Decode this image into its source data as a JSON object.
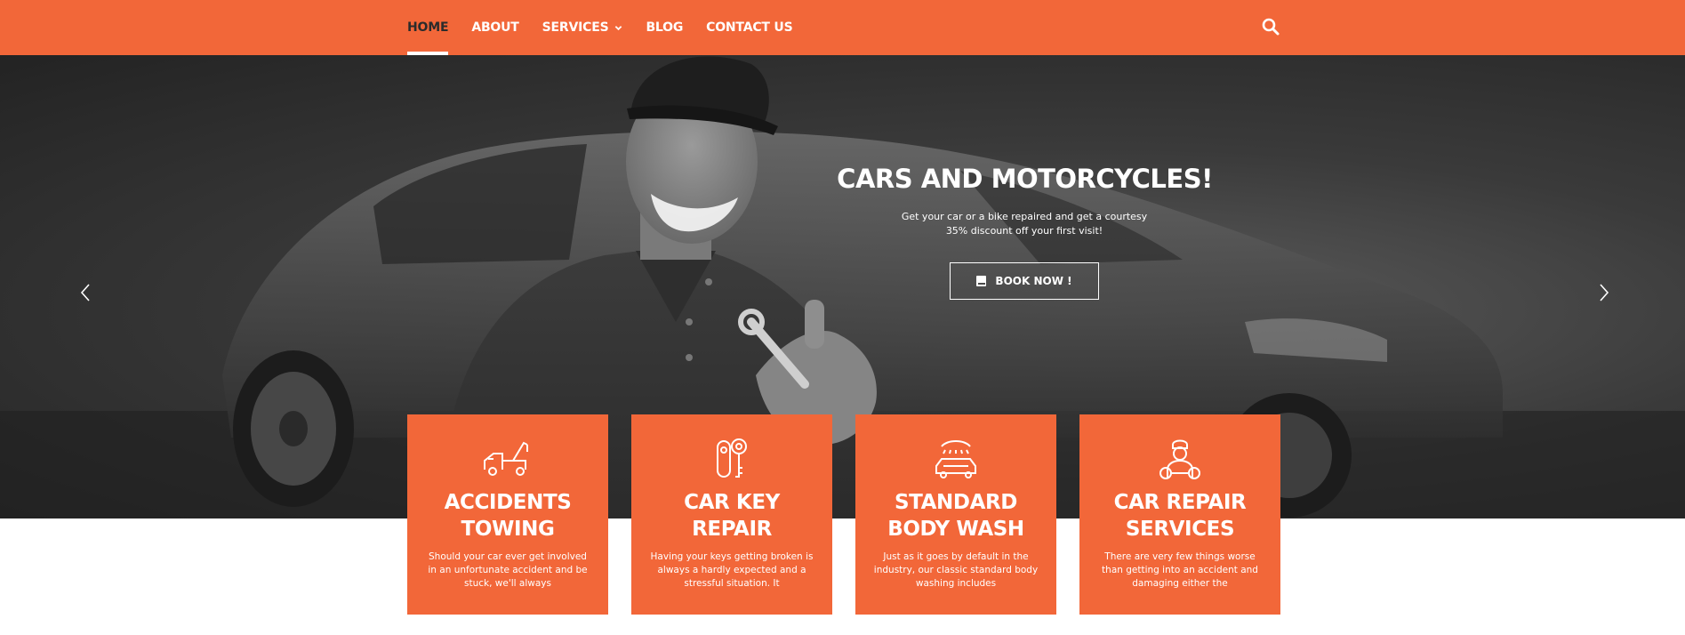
{
  "nav": {
    "items": [
      {
        "label": "HOME"
      },
      {
        "label": "ABOUT"
      },
      {
        "label": "SERVICES"
      },
      {
        "label": "BLOG"
      },
      {
        "label": "CONTACT US"
      }
    ],
    "active": "HOME"
  },
  "hero": {
    "title": "CARS AND MOTORCYCLES!",
    "subtitle_line1": "Get your car or a bike repaired and get a courtesy",
    "subtitle_line2": "35% discount off your first visit!",
    "button_label": "BOOK NOW !"
  },
  "cards": [
    {
      "icon": "tow-truck-icon",
      "title_line1": "ACCIDENTS",
      "title_line2": "TOWING",
      "desc": "Should your car ever get involved in an unfortunate accident and be stuck, we'll always"
    },
    {
      "icon": "car-key-icon",
      "title_line1": "CAR KEY",
      "title_line2": "REPAIR",
      "desc": "Having your keys getting broken is always a hardly expected and a stressful situation. It"
    },
    {
      "icon": "car-wash-icon",
      "title_line1": "STANDARD",
      "title_line2": "BODY WASH",
      "desc": "Just as it goes by default in the industry, our classic standard body washing includes"
    },
    {
      "icon": "mechanic-icon",
      "title_line1": "CAR REPAIR",
      "title_line2": "SERVICES",
      "desc": "There are very few things worse than getting into an accident and damaging either the"
    }
  ],
  "colors": {
    "accent": "#f26739",
    "hero_dark": "#2e2e2e",
    "text_white": "#ffffff"
  }
}
